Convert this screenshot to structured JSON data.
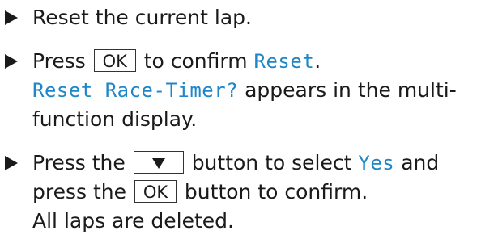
{
  "steps": [
    {
      "text": "Reset the current lap."
    },
    {
      "pre": "Press",
      "key": "OK",
      "mid": "to confirm",
      "display": "Reset",
      "end": ".",
      "result_display": "Reset Race-Timer?",
      "result_text_1": "appears in the multi-",
      "result_text_2": "function display."
    },
    {
      "pre": "Press the",
      "key_icon": "down-arrow-icon",
      "mid": "button to select",
      "display": "Yes",
      "end": "and",
      "line2_pre": "press the",
      "key": "OK",
      "line2_end": "button to confirm.",
      "result_text": "All laps are deleted."
    }
  ],
  "colors": {
    "display_text": "#1f86c8",
    "body_text": "#1a1a1a"
  }
}
